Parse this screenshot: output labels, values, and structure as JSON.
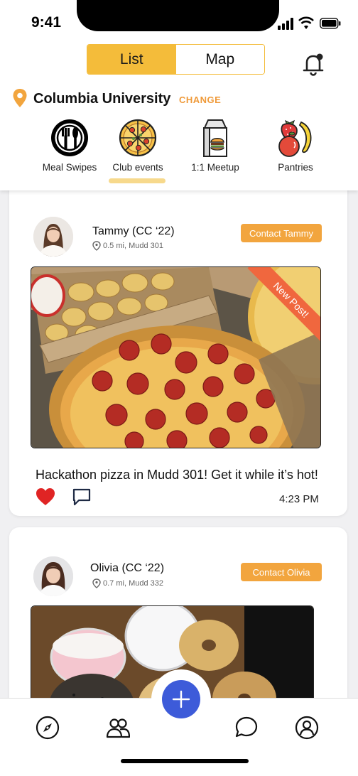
{
  "status": {
    "time": "9:41"
  },
  "header": {
    "view_toggle": {
      "list_label": "List",
      "map_label": "Map",
      "selected": "List"
    },
    "location": {
      "name": "Columbia University",
      "change_label": "CHANGE"
    },
    "categories": [
      {
        "label": "Meal Swipes",
        "icon": "plate-cutlery-icon"
      },
      {
        "label": "Club events",
        "icon": "pizza-icon",
        "selected": true
      },
      {
        "label": "1:1 Meetup",
        "icon": "takeout-bag-icon"
      },
      {
        "label": "Pantries",
        "icon": "fruit-icon"
      }
    ]
  },
  "posts": [
    {
      "user": "Tammy (CC ‘22)",
      "location": "0.5 mi, Mudd 301",
      "contact_label": "Contact Tammy",
      "badge": "New Post!",
      "text": "Hackathon pizza in Mudd 301! Get it while it’s hot!",
      "time": "4:23 PM",
      "liked": true
    },
    {
      "user": "Olivia (CC ‘22)",
      "location": "0.7 mi, Mudd 332",
      "contact_label": "Contact Olivia"
    }
  ],
  "colors": {
    "accent": "#f4bc3a",
    "contact": "#f2a53e",
    "ribbon": "#f0673e",
    "fab": "#3d5bd9",
    "like": "#e02424"
  }
}
